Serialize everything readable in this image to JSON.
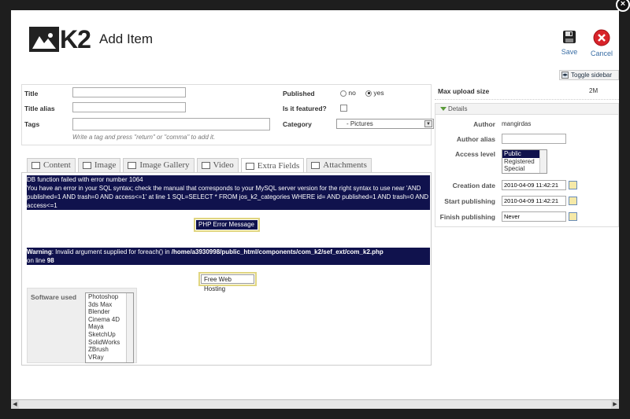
{
  "header": {
    "logo_text": "K2",
    "page_title": "Add Item",
    "save_label": "Save",
    "cancel_label": "Cancel",
    "toggle_sidebar": "Toggle sidebar",
    "close_glyph": "×"
  },
  "basic": {
    "title_label": "Title",
    "title_value": "",
    "alias_label": "Title alias",
    "alias_value": "",
    "tags_label": "Tags",
    "tags_value": "",
    "tags_hint": "Write a tag and press \"return\" or \"comma\" to add it.",
    "published_label": "Published",
    "published_no": "no",
    "published_yes": "yes",
    "featured_label": "Is it featured?",
    "category_label": "Category",
    "category_value": "- Pictures"
  },
  "tabs": [
    {
      "label": "Content",
      "icon": "document-icon"
    },
    {
      "label": "Image",
      "icon": "image-icon"
    },
    {
      "label": "Image Gallery",
      "icon": "gallery-icon"
    },
    {
      "label": "Video",
      "icon": "video-icon"
    },
    {
      "label": "Extra Fields",
      "icon": "puzzle-icon"
    },
    {
      "label": "Attachments",
      "icon": "paperclip-icon"
    }
  ],
  "content": {
    "db_error": "DB function failed with error number 1064",
    "sql_error": "You have an error in your SQL syntax; check the manual that corresponds to your MySQL server version for the right syntax to use near 'AND published=1 AND trash=0 AND access<=1' at line 1 SQL=SELECT * FROM jos_k2_categories WHERE id= AND published=1 AND trash=0 AND access<=1",
    "php_error_button": "PHP Error Message",
    "warning_label": "Warning",
    "warning_text": ": Invalid argument supplied for foreach() in ",
    "warning_path": "/home/a3930998/public_html/components/com_k2/sef_ext/com_k2.php",
    "warning_line_prefix": " on line ",
    "warning_line": "98",
    "free_hosting_button": "Free Web Hosting",
    "software_label": "Software used",
    "software_options": [
      "Photoshop",
      "3ds Max",
      "Blender",
      "Cinema 4D",
      "Maya",
      "SketchUp",
      "SolidWorks",
      "ZBrush",
      "VRay"
    ]
  },
  "sidebar": {
    "max_upload_label": "Max upload size",
    "max_upload_value": "2M",
    "details_label": "Details",
    "author_label": "Author",
    "author_value": "mangirdas",
    "alias_label": "Author alias",
    "alias_value": "",
    "access_label": "Access level",
    "access_options": [
      "Public",
      "Registered",
      "Special"
    ],
    "created_label": "Creation date",
    "created_value": "2010-04-09 11:42:21",
    "start_label": "Start publishing",
    "start_value": "2010-04-09 11:42:21",
    "finish_label": "Finish publishing",
    "finish_value": "Never"
  },
  "colors": {
    "error_bg": "#10124d",
    "accent_blue": "#3a6ea5",
    "cancel_red": "#d8232a"
  }
}
